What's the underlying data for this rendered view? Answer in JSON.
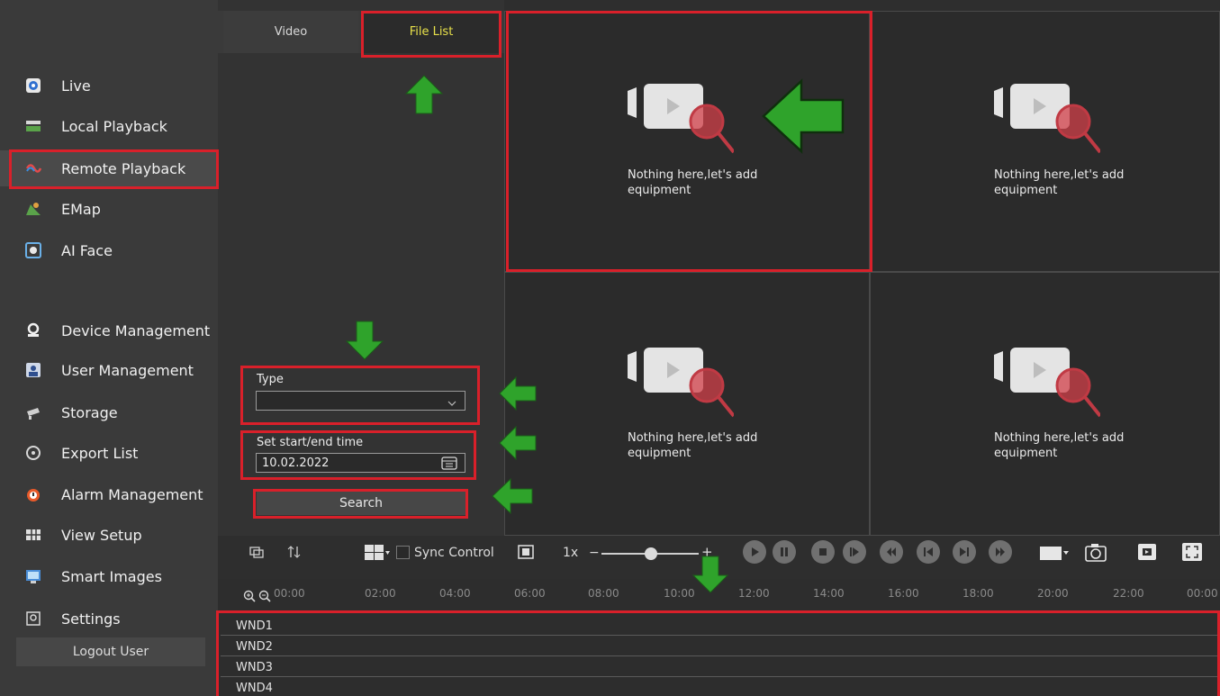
{
  "sidebar": {
    "items": [
      {
        "label": "Live",
        "icon": "live-icon"
      },
      {
        "label": "Local Playback",
        "icon": "local-playback-icon"
      },
      {
        "label": "Remote Playback",
        "icon": "remote-playback-icon"
      },
      {
        "label": "EMap",
        "icon": "emap-icon"
      },
      {
        "label": "AI Face",
        "icon": "ai-face-icon"
      },
      {
        "label": "Device Management",
        "icon": "device-management-icon"
      },
      {
        "label": "User Management",
        "icon": "user-management-icon"
      },
      {
        "label": "Storage",
        "icon": "storage-icon"
      },
      {
        "label": "Export List",
        "icon": "export-list-icon"
      },
      {
        "label": "Alarm Management",
        "icon": "alarm-icon"
      },
      {
        "label": "View Setup",
        "icon": "view-setup-icon"
      },
      {
        "label": "Smart Images",
        "icon": "smart-images-icon"
      },
      {
        "label": "Settings",
        "icon": "settings-icon"
      }
    ],
    "active": "Remote Playback",
    "logout_label": "Logout User"
  },
  "tabs": [
    {
      "label": "Video"
    },
    {
      "label": "File List"
    }
  ],
  "search_panel": {
    "type_label": "Type",
    "type_value": "",
    "time_label": "Set start/end time",
    "date_value": "10.02.2022",
    "search_label": "Search"
  },
  "video_grid": {
    "cells": [
      {
        "message": "Nothing here,let's add equipment"
      },
      {
        "message": "Nothing here,let's add equipment"
      },
      {
        "message": "Nothing here,let's add equipment"
      },
      {
        "message": "Nothing here,let's add equipment"
      }
    ]
  },
  "controls": {
    "sync_label": "Sync Control",
    "speed": "1x",
    "minus": "−",
    "plus": "+"
  },
  "timeline": {
    "ticks": [
      "00:00",
      "02:00",
      "04:00",
      "06:00",
      "08:00",
      "10:00",
      "12:00",
      "14:00",
      "16:00",
      "18:00",
      "20:00",
      "22:00",
      "00:00"
    ],
    "channels": [
      "WND1",
      "WND2",
      "WND3",
      "WND4"
    ]
  },
  "colors": {
    "annotation_red": "#d9202a",
    "annotation_green": "#2fa32b",
    "active_tab_text": "#e7e04a",
    "search_icon_red": "#d2404a"
  }
}
